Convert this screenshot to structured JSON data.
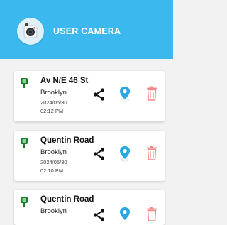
{
  "header": {
    "title": "USER CAMERA",
    "app_icon": "camera-icon"
  },
  "colors": {
    "header_bg": "#3bb9ee",
    "pin_green": "#1f7a2a",
    "map_blue": "#29a7e3",
    "trash_red": "#ef8b8b",
    "share_black": "#111111"
  },
  "icons": {
    "location": "location-pin-icon",
    "share": "share-icon",
    "map": "map-marker-icon",
    "delete": "trash-icon"
  },
  "records": [
    {
      "street": "Av N/E 46 St",
      "borough": "Brooklyn",
      "date": "2024/05/30",
      "time": "02:12 PM"
    },
    {
      "street": "Quentin Road",
      "borough": "Brooklyn",
      "date": "2024/05/30",
      "time": "02:10 PM"
    },
    {
      "street": "Quentin Road",
      "borough": "Brooklyn"
    }
  ]
}
